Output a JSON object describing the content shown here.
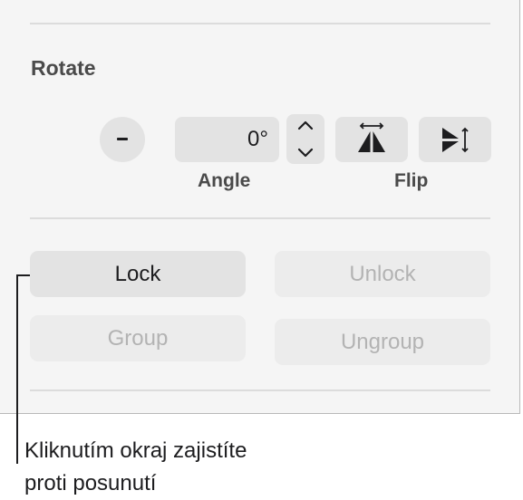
{
  "rotate": {
    "section_title": "Rotate",
    "rotate_button_label": "-",
    "angle_value": "0°",
    "angle_caption": "Angle",
    "flip_caption": "Flip",
    "icons": {
      "stepper": "up-down-chevron-icon",
      "flip_horizontal": "flip-horizontal-icon",
      "flip_vertical": "flip-vertical-icon"
    }
  },
  "arrange": {
    "lock_label": "Lock",
    "unlock_label": "Unlock",
    "group_label": "Group",
    "ungroup_label": "Ungroup"
  },
  "callout": {
    "line1": "Kliknutím okraj zajistíte",
    "line2": "proti posunutí"
  },
  "colors": {
    "panel_background": "#f5f5f5",
    "button_background": "#e3e3e3",
    "disabled_text": "#b3b3b3",
    "text": "#1d1d1f"
  }
}
